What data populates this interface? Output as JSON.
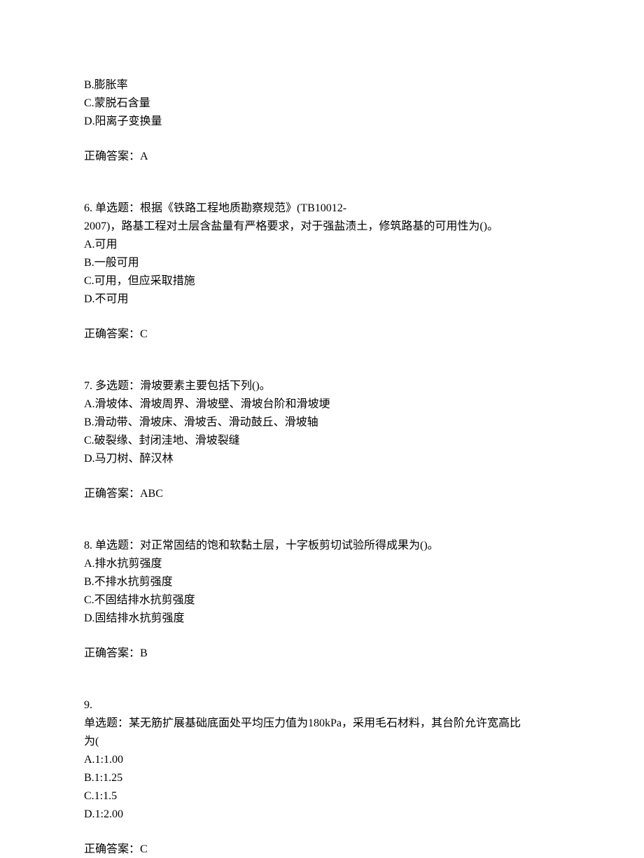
{
  "q5_remainder": {
    "optB": "B.膨胀率",
    "optC": "C.蒙脱石含量",
    "optD": "D.阳离子变换量",
    "answer": "正确答案：A"
  },
  "q6": {
    "num": "6.",
    "type": "单选题：",
    "stem1": "根据《铁路工程地质勘察规范》(TB10012-",
    "stem2": "2007)，路基工程对土层含盐量有严格要求，对于强盐渍土，修筑路基的可用性为()。",
    "optA": "A.可用",
    "optB": "B.一般可用",
    "optC": "C.可用，但应采取措施",
    "optD": "D.不可用",
    "answer": "正确答案：C"
  },
  "q7": {
    "num": "7.",
    "type": "多选题：",
    "stem": "滑坡要素主要包括下列()。",
    "optA": "A.滑坡体、滑坡周界、滑坡壁、滑坡台阶和滑坡埂",
    "optB": "B.滑动带、滑坡床、滑坡舌、滑动鼓丘、滑坡轴",
    "optC": "C.破裂缘、封闭洼地、滑坡裂缝",
    "optD": "D.马刀树、醉汉林",
    "answer": "正确答案：ABC"
  },
  "q8": {
    "num": "8.",
    "type": "单选题：",
    "stem": "对正常固结的饱和软黏土层，十字板剪切试验所得成果为()。",
    "optA": "A.排水抗剪强度",
    "optB": "B.不排水抗剪强度",
    "optC": "C.不固结排水抗剪强度",
    "optD": "D.固结排水抗剪强度",
    "answer": "正确答案：B"
  },
  "q9": {
    "num": "9.",
    "type": "单选题：",
    "stem1": "某无筋扩展基础底面处平均压力值为180kPa，采用毛石材料，其台阶允许宽高比",
    "stem2": "为(",
    "optA": "A.1:1.00",
    "optB": "B.1:1.25",
    "optC": "C.1:1.5",
    "optD": "D.1:2.00",
    "answer": "正确答案：C"
  }
}
